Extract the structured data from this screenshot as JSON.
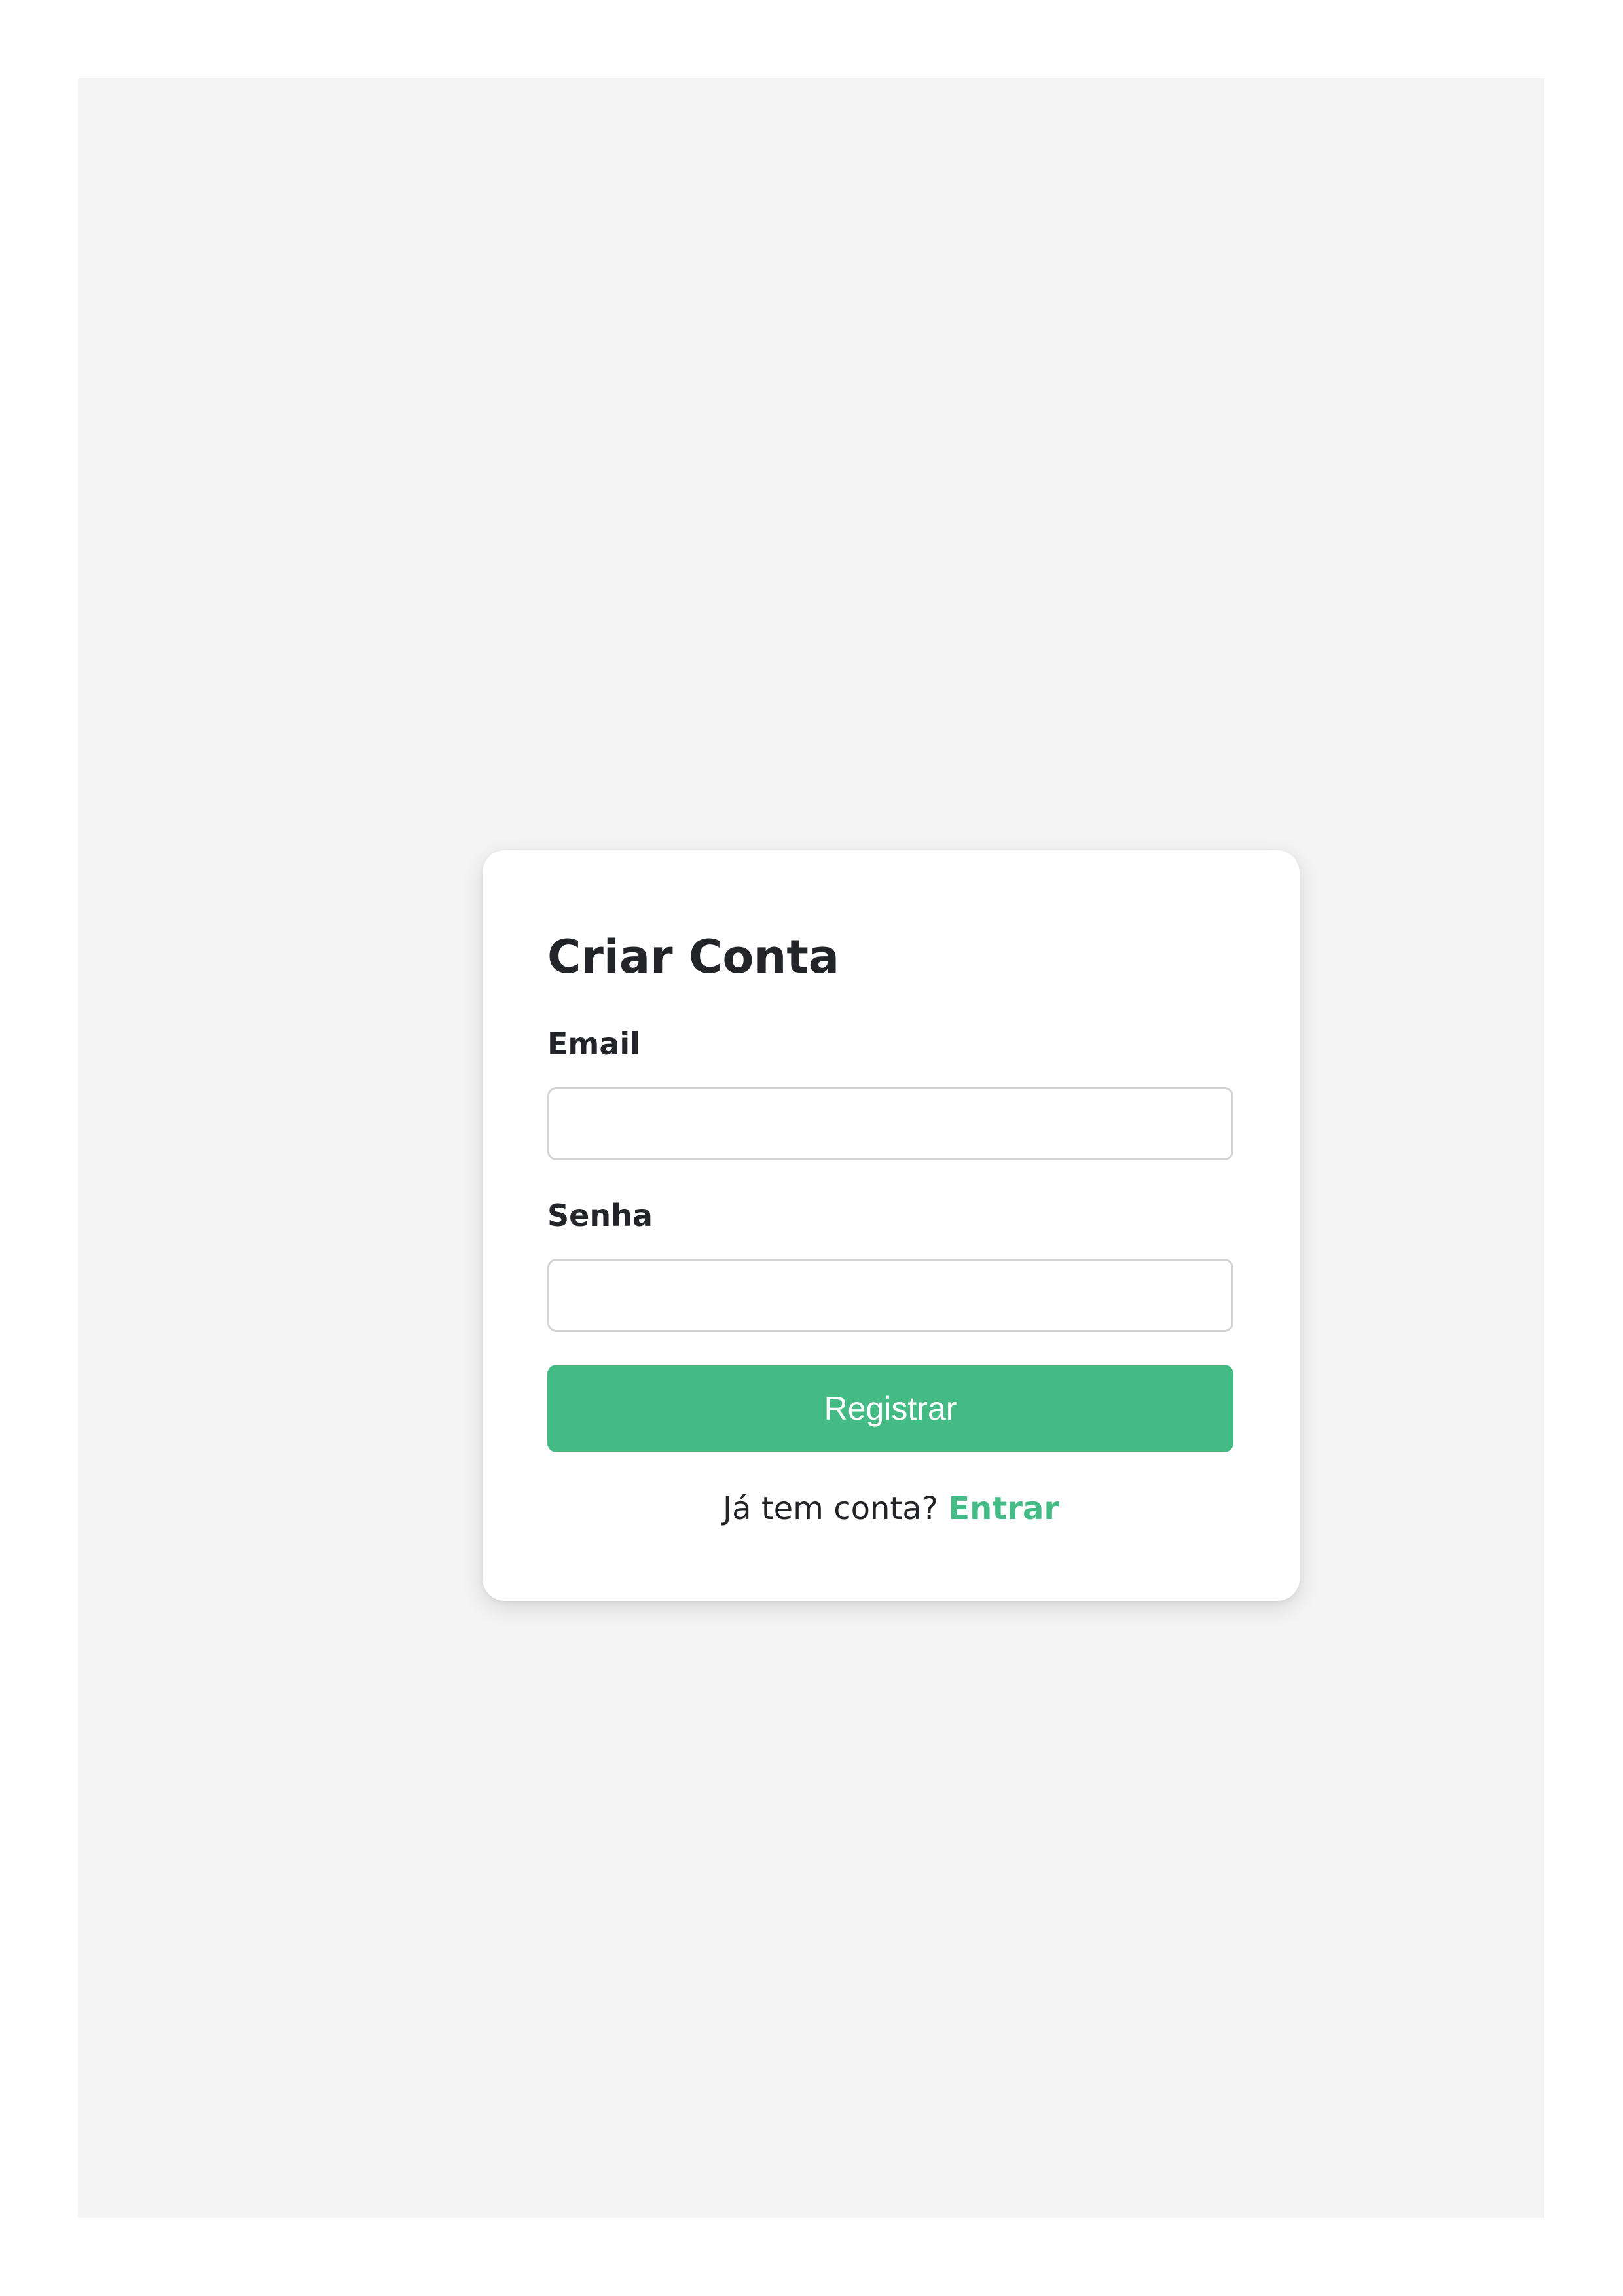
{
  "form": {
    "title": "Criar Conta",
    "email_label": "Email",
    "email_value": "",
    "password_label": "Senha",
    "password_value": "",
    "submit_label": "Registrar",
    "footer_text": "Já tem conta?",
    "login_link": "Entrar"
  },
  "colors": {
    "accent": "#44bb85",
    "page_background": "#f4f4f4",
    "card_background": "#ffffff",
    "text": "#222428"
  }
}
